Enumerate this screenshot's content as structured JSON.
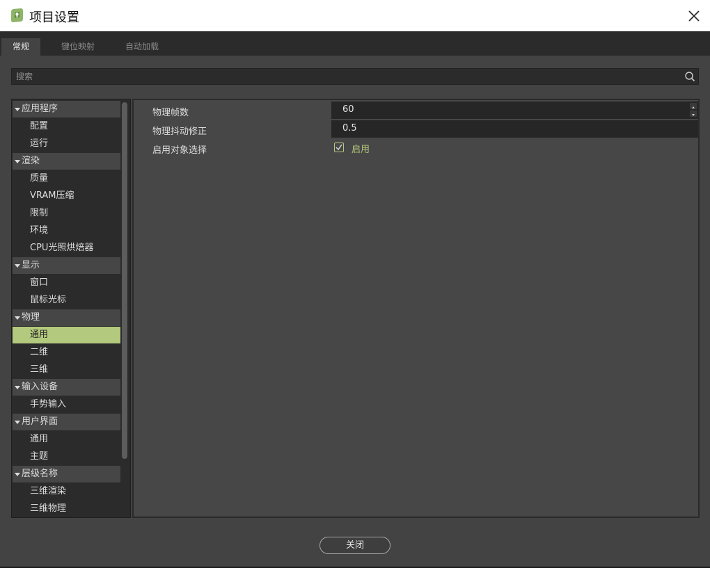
{
  "window": {
    "title": "项目设置",
    "accent": "#b3c97d"
  },
  "tabs": [
    {
      "label": "常规",
      "active": true
    },
    {
      "label": "键位映射",
      "active": false
    },
    {
      "label": "自动加载",
      "active": false
    }
  ],
  "search": {
    "placeholder": "搜索",
    "value": ""
  },
  "tree": [
    {
      "label": "应用程序",
      "type": "category"
    },
    {
      "label": "配置",
      "type": "item"
    },
    {
      "label": "运行",
      "type": "item"
    },
    {
      "label": "渲染",
      "type": "category"
    },
    {
      "label": "质量",
      "type": "item"
    },
    {
      "label": "VRAM压缩",
      "type": "item"
    },
    {
      "label": "限制",
      "type": "item"
    },
    {
      "label": "环境",
      "type": "item"
    },
    {
      "label": "CPU光照烘焙器",
      "type": "item"
    },
    {
      "label": "显示",
      "type": "category"
    },
    {
      "label": "窗口",
      "type": "item"
    },
    {
      "label": "鼠标光标",
      "type": "item"
    },
    {
      "label": "物理",
      "type": "category"
    },
    {
      "label": "通用",
      "type": "item",
      "selected": true
    },
    {
      "label": "二维",
      "type": "item"
    },
    {
      "label": "三维",
      "type": "item"
    },
    {
      "label": "输入设备",
      "type": "category"
    },
    {
      "label": "手势输入",
      "type": "item"
    },
    {
      "label": "用户界面",
      "type": "category"
    },
    {
      "label": "通用",
      "type": "item"
    },
    {
      "label": "主题",
      "type": "item"
    },
    {
      "label": "层级名称",
      "type": "category"
    },
    {
      "label": "三维渲染",
      "type": "item"
    },
    {
      "label": "三维物理",
      "type": "item"
    }
  ],
  "properties": {
    "physics_ticks": {
      "label": "物理帧数",
      "value": "60"
    },
    "jitter_fix": {
      "label": "物理抖动修正",
      "value": "0.5"
    },
    "object_picking": {
      "label": "启用对象选择",
      "checkbox_label": "启用",
      "checked": true
    }
  },
  "footer": {
    "close_label": "关闭"
  }
}
